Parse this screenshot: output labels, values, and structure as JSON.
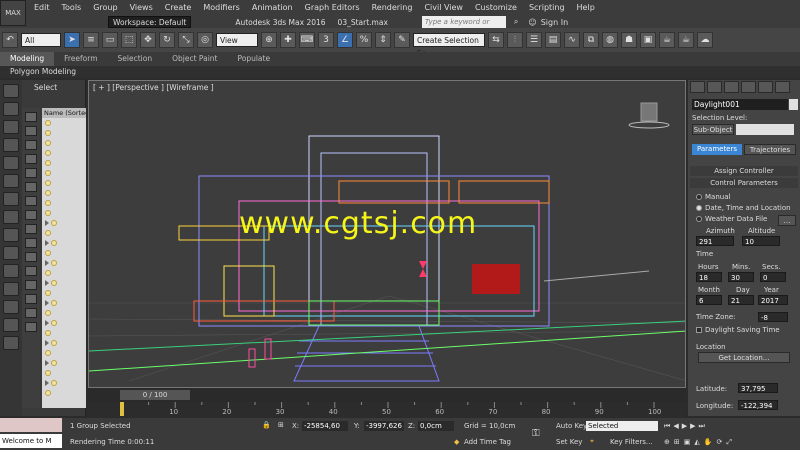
{
  "app": {
    "logo": "MAX",
    "workspace": "Workspace: Default",
    "title": "Autodesk 3ds Max 2016",
    "file": "03_Start.max",
    "search_placeholder": "Type a keyword or phrase",
    "signin": "Sign In"
  },
  "menu": [
    "Edit",
    "Tools",
    "Group",
    "Views",
    "Create",
    "Modifiers",
    "Animation",
    "Graph Editors",
    "Rendering",
    "Civil View",
    "Customize",
    "Scripting",
    "Help"
  ],
  "toolbar": {
    "filter": "All",
    "view": "View",
    "selection_set": "Create Selection Se",
    "snap_number": "3"
  },
  "ribbon": {
    "tabs": [
      "Modeling",
      "Freeform",
      "Selection",
      "Object Paint",
      "Populate"
    ],
    "sub": "Polygon Modeling"
  },
  "explorer": {
    "select": "Select",
    "column": "Name (Sorted"
  },
  "viewport": {
    "label": "[ + ] [Perspective ] [Wireframe ]",
    "watermark": "www.cgtsj.com"
  },
  "timeline": {
    "frame": "0 / 100",
    "ticks": [
      "10",
      "20",
      "30",
      "40",
      "50",
      "60",
      "70",
      "80",
      "90",
      "100"
    ],
    "tick_values": [
      10,
      20,
      30,
      40,
      50,
      60,
      70,
      80,
      90,
      100
    ]
  },
  "panel": {
    "object_name": "Daylight001",
    "selection_level": "Selection Level:",
    "sub_object": "Sub-Object",
    "tab_parameters": "Parameters",
    "tab_trajectories": "Trajectories",
    "assign_controller": "Assign Controller",
    "control_parameters": "Control Parameters",
    "radio_manual": "Manual",
    "radio_date": "Date, Time and Location",
    "radio_weather": "Weather Data File",
    "azimuth_label": "Azimuth",
    "altitude_label": "Altitude",
    "azimuth": "291",
    "altitude": "10",
    "time_label": "Time",
    "hours_label": "Hours",
    "mins_label": "Mins.",
    "secs_label": "Secs.",
    "hours": "18",
    "mins": "30",
    "secs": "0",
    "month_label": "Month",
    "day_label": "Day",
    "year_label": "Year",
    "month": "6",
    "day": "21",
    "year": "2017",
    "timezone_label": "Time Zone:",
    "timezone": "-8",
    "dst": "Daylight Saving Time",
    "location_label": "Location",
    "get_location": "Get Location...",
    "latitude_label": "Latitude:",
    "latitude": "37,795",
    "longitude_label": "Longitude:",
    "longitude": "-122,394"
  },
  "status": {
    "listener": "Welcome to M",
    "selected": "1 Group Selected",
    "rendering": "Rendering Time  0:00:11",
    "x_label": "X:",
    "x": "-25854,60",
    "y_label": "Y:",
    "y": "-3997,626",
    "z_label": "Z:",
    "z": "0,0cm",
    "grid": "Grid = 10,0cm",
    "add_time_tag": "Add Time Tag",
    "auto_key": "Auto Key",
    "auto_key_value": "Selected",
    "set_key": "Set Key",
    "key_filters": "Key Filters..."
  }
}
